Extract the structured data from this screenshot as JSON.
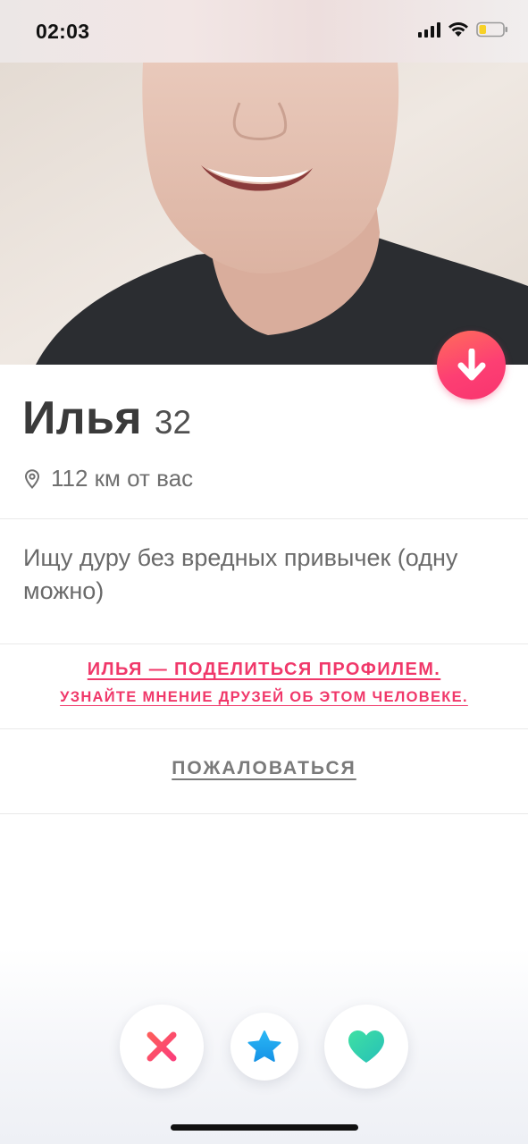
{
  "status_bar": {
    "time": "02:03",
    "icons": [
      "signal-icon",
      "wifi-icon",
      "battery-icon"
    ],
    "battery_level": 0.3
  },
  "profile": {
    "name": "Илья",
    "age": "32",
    "distance": "112 км от вас",
    "bio": "Ищу дуру без вредных привычек (одну можно)"
  },
  "share": {
    "title": "ИЛЬЯ — ПОДЕЛИТЬСЯ ПРОФИЛЕМ.",
    "subtitle": "УЗНАЙТЕ МНЕНИЕ ДРУЗЕЙ ОБ ЭТОМ ЧЕЛОВЕКЕ."
  },
  "report_label": "ПОЖАЛОВАТЬСЯ",
  "actions": {
    "nope_icon": "close-icon",
    "superlike_icon": "star-icon",
    "like_icon": "heart-icon"
  },
  "colors": {
    "accent": "#f0386a",
    "nope": "#fd4f64",
    "superlike": "#1ea7f2",
    "like": "#2ed3a7",
    "battery": "#f7d128"
  }
}
